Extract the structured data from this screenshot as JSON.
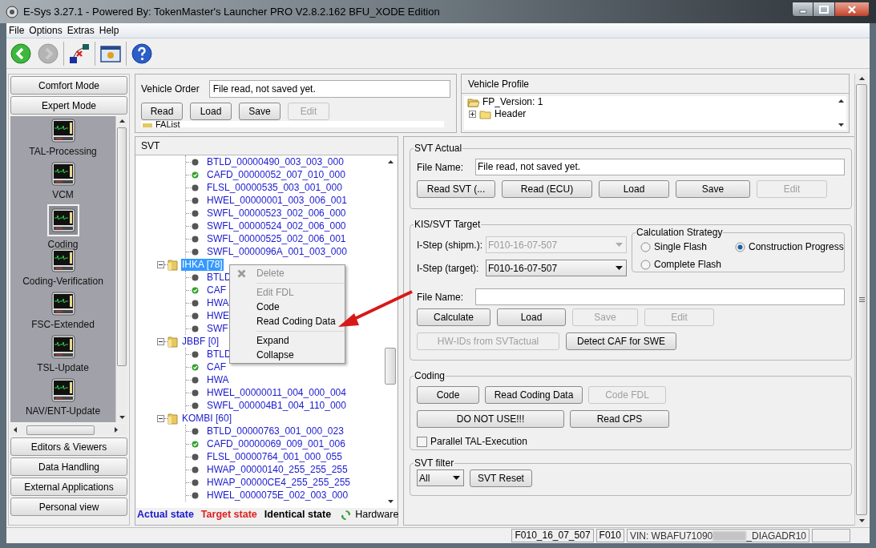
{
  "window": {
    "title": "E-Sys 3.27.1 - Powered By: TokenMaster's Launcher PRO V2.8.2.162 BFU_XODE Edition"
  },
  "menu_bar": [
    "File",
    "Options",
    "Extras",
    "Help"
  ],
  "sidebar": {
    "top_buttons": [
      "Comfort Mode",
      "Expert Mode"
    ],
    "items": [
      {
        "label": "TAL-Processing",
        "selected": false
      },
      {
        "label": "VCM",
        "selected": false
      },
      {
        "label": "Coding",
        "selected": true
      },
      {
        "label": "Coding-Verification",
        "selected": false
      },
      {
        "label": "FSC-Extended",
        "selected": false
      },
      {
        "label": "TSL-Update",
        "selected": false
      },
      {
        "label": "NAV/ENT-Update",
        "selected": false
      }
    ],
    "bottom_buttons": [
      "Editors & Viewers",
      "Data Handling",
      "External Applications",
      "Personal view"
    ]
  },
  "vehicle_order": {
    "label": "Vehicle Order",
    "value": "File read, not saved yet.",
    "buttons": [
      {
        "label": "Read",
        "disabled": false
      },
      {
        "label": "Load",
        "disabled": false
      },
      {
        "label": "Save",
        "disabled": false
      },
      {
        "label": "Edit",
        "disabled": true
      }
    ],
    "list_item": "FAList"
  },
  "vehicle_profile": {
    "title": "Vehicle Profile",
    "items": [
      {
        "label": "FP_Version: 1",
        "kind": "open"
      },
      {
        "label": "Header",
        "kind": "closed"
      }
    ]
  },
  "svt": {
    "title": "SVT",
    "tree": [
      {
        "children": [
          {
            "label": "BTLD_00000490_003_003_000",
            "kind": "unit"
          },
          {
            "label": "CAFD_00000052_007_010_000",
            "kind": "hardware"
          },
          {
            "label": "FLSL_00000535_003_001_000",
            "kind": "unit"
          },
          {
            "label": "HWEL_00000001_003_006_001",
            "kind": "unit"
          },
          {
            "label": "SWFL_00000523_002_006_000",
            "kind": "unit"
          },
          {
            "label": "SWFL_00000524_002_006_000",
            "kind": "unit"
          },
          {
            "label": "SWFL_00000525_002_006_001",
            "kind": "unit"
          },
          {
            "label": "SWFL_0000096A_001_003_000",
            "kind": "unit"
          }
        ]
      },
      {
        "label": "IHKA [78]",
        "selected": true,
        "children": [
          {
            "label": "BTLD",
            "kind": "unit"
          },
          {
            "label": "CAF",
            "kind": "hardware"
          },
          {
            "label": "HWA",
            "kind": "unit"
          },
          {
            "label": "HWE",
            "kind": "unit"
          },
          {
            "label": "SWF",
            "kind": "unit"
          }
        ]
      },
      {
        "label": "JBBF [0]",
        "selected": false,
        "children": [
          {
            "label": "BTLD",
            "kind": "unit"
          },
          {
            "label": "CAF",
            "kind": "hardware"
          },
          {
            "label": "HWA",
            "kind": "unit"
          },
          {
            "label": "HWEL_00000011_004_000_004",
            "kind": "unit"
          },
          {
            "label": "SWFL_000004B1_004_110_000",
            "kind": "unit"
          }
        ]
      },
      {
        "label": "KOMBI [60]",
        "selected": false,
        "children": [
          {
            "label": "BTLD_00000763_001_000_023",
            "kind": "unit"
          },
          {
            "label": "CAFD_00000069_009_001_006",
            "kind": "hardware"
          },
          {
            "label": "FLSL_00000764_001_000_055",
            "kind": "unit"
          },
          {
            "label": "HWAP_00000140_255_255_255",
            "kind": "unit"
          },
          {
            "label": "HWAP_00000CE4_255_255_255",
            "kind": "unit"
          },
          {
            "label": "HWEL_0000075E_002_003_000",
            "kind": "unit"
          }
        ]
      }
    ],
    "legend": [
      {
        "label": "Actual state",
        "color": "#1a1ad0"
      },
      {
        "label": "Target state",
        "color": "#e02020"
      },
      {
        "label": "Identical state",
        "color": "#000000"
      },
      {
        "label": "Hardware",
        "color": "#000000"
      }
    ]
  },
  "context_menu": {
    "sections": [
      [
        {
          "label": "Delete",
          "disabled": true
        }
      ],
      [
        {
          "label": "Edit FDL",
          "disabled": true
        },
        {
          "label": "Code",
          "disabled": false
        },
        {
          "label": "Read Coding Data",
          "disabled": false
        }
      ],
      [
        {
          "label": "Expand",
          "disabled": false
        },
        {
          "label": "Collapse",
          "disabled": false
        }
      ]
    ]
  },
  "svt_actual": {
    "title": "SVT Actual",
    "file_label": "File Name:",
    "file_value": "File read, not saved yet.",
    "buttons": [
      {
        "label": "Read SVT (...",
        "disabled": false
      },
      {
        "label": "Read (ECU)",
        "disabled": false
      },
      {
        "label": "Load",
        "disabled": false
      },
      {
        "label": "Save",
        "disabled": false
      },
      {
        "label": "Edit",
        "disabled": true
      }
    ]
  },
  "kis_target": {
    "title": "KIS/SVT Target",
    "istep_shipm": {
      "label": "I-Step (shipm.):",
      "value": "F010-16-07-507",
      "disabled": true
    },
    "istep_target": {
      "label": "I-Step (target):",
      "value": "F010-16-07-507",
      "disabled": false
    },
    "strategy": {
      "title": "Calculation Strategy",
      "options": [
        {
          "label": "Single Flash",
          "selected": false
        },
        {
          "label": "Construction Progress",
          "selected": true
        },
        {
          "label": "Complete Flash",
          "selected": false
        }
      ]
    },
    "file_label": "File Name:",
    "buttons": [
      {
        "label": "Calculate",
        "disabled": false
      },
      {
        "label": "Load",
        "disabled": false
      },
      {
        "label": "Save",
        "disabled": true
      },
      {
        "label": "Edit",
        "disabled": true
      }
    ],
    "extra_buttons": [
      {
        "label": "HW-IDs from SVTactual",
        "disabled": true
      },
      {
        "label": "Detect CAF for SWE",
        "disabled": false
      }
    ]
  },
  "coding": {
    "title": "Coding",
    "buttons_row1": [
      {
        "label": "Code",
        "disabled": false
      },
      {
        "label": "Read Coding Data",
        "disabled": false
      },
      {
        "label": "Code FDL",
        "disabled": true
      }
    ],
    "buttons_row2": [
      {
        "label": "DO NOT USE!!!",
        "disabled": false
      },
      {
        "label": "Read CPS",
        "disabled": false
      }
    ],
    "parallel": {
      "label": "Parallel TAL-Execution",
      "checked": false
    }
  },
  "svt_filter": {
    "title": "SVT filter",
    "value": "All",
    "button": "SVT Reset"
  },
  "status_bar": {
    "istep": "F010_16_07_507",
    "series": "F010",
    "vin_prefix": "VIN: WBAFU71090",
    "vin_suffix": "_DIAGADR10"
  }
}
